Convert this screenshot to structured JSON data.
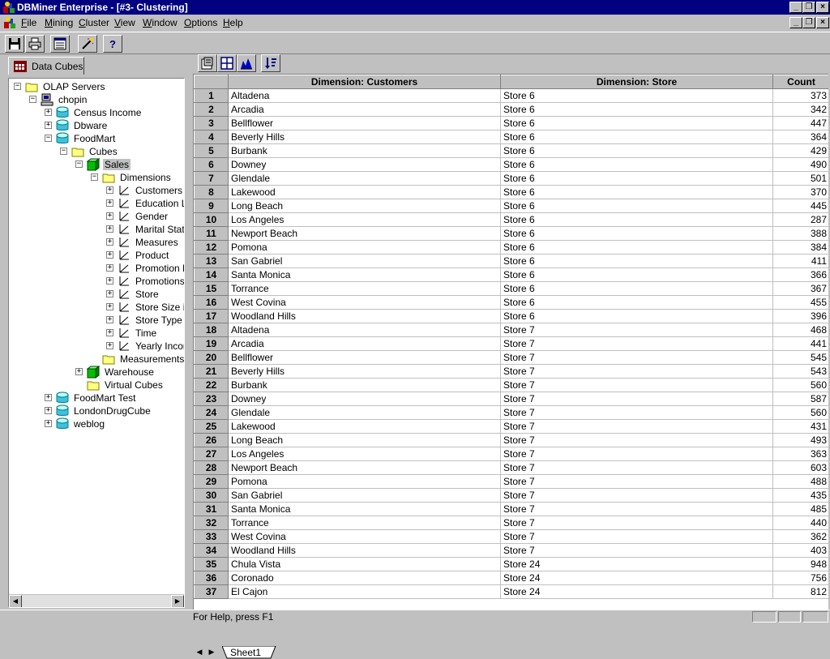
{
  "window": {
    "title": "DBMiner Enterprise - [#3- Clustering]"
  },
  "menu": [
    {
      "label": "File",
      "accel": "F",
      "rest": "ile"
    },
    {
      "label": "Mining",
      "accel": "M",
      "rest": "ining"
    },
    {
      "label": "Cluster",
      "accel": "C",
      "rest": "luster"
    },
    {
      "label": "View",
      "accel": "V",
      "rest": "iew"
    },
    {
      "label": "Window",
      "accel": "W",
      "rest": "indow"
    },
    {
      "label": "Options",
      "accel": "O",
      "rest": "ptions"
    },
    {
      "label": "Help",
      "accel": "H",
      "rest": "elp"
    }
  ],
  "toolbar": {
    "icons": [
      "save-icon",
      "print-icon",
      "properties-icon",
      "wizard-icon",
      "help-icon"
    ],
    "help_glyph": "?"
  },
  "left_panel": {
    "tab_label": "Data Cubes",
    "tree": [
      {
        "label": "OLAP Servers",
        "level": 0,
        "icon": "folder-icon",
        "expander": "minus"
      },
      {
        "label": "chopin",
        "level": 1,
        "icon": "server-icon",
        "expander": "minus"
      },
      {
        "label": "Census Income",
        "level": 2,
        "icon": "database-icon",
        "expander": "plus"
      },
      {
        "label": "Dbware",
        "level": 2,
        "icon": "database-icon",
        "expander": "plus"
      },
      {
        "label": "FoodMart",
        "level": 2,
        "icon": "database-icon",
        "expander": "minus"
      },
      {
        "label": "Cubes",
        "level": 3,
        "icon": "folder-icon",
        "expander": "minus"
      },
      {
        "label": "Sales",
        "level": 4,
        "icon": "cube-icon",
        "expander": "minus",
        "selected": true
      },
      {
        "label": "Dimensions",
        "level": 5,
        "icon": "folder-icon",
        "expander": "minus"
      },
      {
        "label": "Customers",
        "level": 6,
        "icon": "dimension-icon",
        "expander": "plus"
      },
      {
        "label": "Education L",
        "level": 6,
        "icon": "dimension-icon",
        "expander": "plus"
      },
      {
        "label": "Gender",
        "level": 6,
        "icon": "dimension-icon",
        "expander": "plus"
      },
      {
        "label": "Marital Statu",
        "level": 6,
        "icon": "dimension-icon",
        "expander": "plus"
      },
      {
        "label": "Measures",
        "level": 6,
        "icon": "dimension-icon",
        "expander": "plus"
      },
      {
        "label": "Product",
        "level": 6,
        "icon": "dimension-icon",
        "expander": "plus"
      },
      {
        "label": "Promotion M",
        "level": 6,
        "icon": "dimension-icon",
        "expander": "plus"
      },
      {
        "label": "Promotions",
        "level": 6,
        "icon": "dimension-icon",
        "expander": "plus"
      },
      {
        "label": "Store",
        "level": 6,
        "icon": "dimension-icon",
        "expander": "plus"
      },
      {
        "label": "Store Size ir",
        "level": 6,
        "icon": "dimension-icon",
        "expander": "plus"
      },
      {
        "label": "Store Type",
        "level": 6,
        "icon": "dimension-icon",
        "expander": "plus"
      },
      {
        "label": "Time",
        "level": 6,
        "icon": "dimension-icon",
        "expander": "plus"
      },
      {
        "label": "Yearly Incor",
        "level": 6,
        "icon": "dimension-icon",
        "expander": "plus"
      },
      {
        "label": "Measurements",
        "level": 5,
        "icon": "folder-icon",
        "expander": "none"
      },
      {
        "label": "Warehouse",
        "level": 4,
        "icon": "cube-icon",
        "expander": "plus"
      },
      {
        "label": "Virtual Cubes",
        "level": 4,
        "icon": "folder-icon",
        "expander": "none"
      },
      {
        "label": "FoodMart Test",
        "level": 2,
        "icon": "database-icon",
        "expander": "plus"
      },
      {
        "label": "LondonDrugCube",
        "level": 2,
        "icon": "database-icon",
        "expander": "plus"
      },
      {
        "label": "weblog",
        "level": 2,
        "icon": "database-icon",
        "expander": "plus"
      }
    ]
  },
  "grid": {
    "toolbar_icons": [
      "cube-properties-icon",
      "grid-view-icon",
      "cluster-chart-icon",
      "sort-icon"
    ],
    "columns": [
      "Dimension: Customers",
      "Dimension: Store",
      "Count"
    ],
    "rows": [
      [
        "1",
        "Altadena",
        "Store 6",
        "373"
      ],
      [
        "2",
        "Arcadia",
        "Store 6",
        "342"
      ],
      [
        "3",
        "Bellflower",
        "Store 6",
        "447"
      ],
      [
        "4",
        "Beverly Hills",
        "Store 6",
        "364"
      ],
      [
        "5",
        "Burbank",
        "Store 6",
        "429"
      ],
      [
        "6",
        "Downey",
        "Store 6",
        "490"
      ],
      [
        "7",
        "Glendale",
        "Store 6",
        "501"
      ],
      [
        "8",
        "Lakewood",
        "Store 6",
        "370"
      ],
      [
        "9",
        "Long Beach",
        "Store 6",
        "445"
      ],
      [
        "10",
        "Los Angeles",
        "Store 6",
        "287"
      ],
      [
        "11",
        "Newport Beach",
        "Store 6",
        "388"
      ],
      [
        "12",
        "Pomona",
        "Store 6",
        "384"
      ],
      [
        "13",
        "San Gabriel",
        "Store 6",
        "411"
      ],
      [
        "14",
        "Santa Monica",
        "Store 6",
        "366"
      ],
      [
        "15",
        "Torrance",
        "Store 6",
        "367"
      ],
      [
        "16",
        "West Covina",
        "Store 6",
        "455"
      ],
      [
        "17",
        "Woodland Hills",
        "Store 6",
        "396"
      ],
      [
        "18",
        "Altadena",
        "Store 7",
        "468"
      ],
      [
        "19",
        "Arcadia",
        "Store 7",
        "441"
      ],
      [
        "20",
        "Bellflower",
        "Store 7",
        "545"
      ],
      [
        "21",
        "Beverly Hills",
        "Store 7",
        "543"
      ],
      [
        "22",
        "Burbank",
        "Store 7",
        "560"
      ],
      [
        "23",
        "Downey",
        "Store 7",
        "587"
      ],
      [
        "24",
        "Glendale",
        "Store 7",
        "560"
      ],
      [
        "25",
        "Lakewood",
        "Store 7",
        "431"
      ],
      [
        "26",
        "Long Beach",
        "Store 7",
        "493"
      ],
      [
        "27",
        "Los Angeles",
        "Store 7",
        "363"
      ],
      [
        "28",
        "Newport Beach",
        "Store 7",
        "603"
      ],
      [
        "29",
        "Pomona",
        "Store 7",
        "488"
      ],
      [
        "30",
        "San Gabriel",
        "Store 7",
        "435"
      ],
      [
        "31",
        "Santa Monica",
        "Store 7",
        "485"
      ],
      [
        "32",
        "Torrance",
        "Store 7",
        "440"
      ],
      [
        "33",
        "West Covina",
        "Store 7",
        "362"
      ],
      [
        "34",
        "Woodland Hills",
        "Store 7",
        "403"
      ],
      [
        "35",
        "Chula Vista",
        "Store 24",
        "948"
      ],
      [
        "36",
        "Coronado",
        "Store 24",
        "756"
      ],
      [
        "37",
        "El Cajon",
        "Store 24",
        "812"
      ]
    ],
    "sheet_tab": "Sheet1"
  },
  "status": {
    "text": "For Help, press F1"
  },
  "colors": {
    "title_bar": "#000080",
    "face": "#c0c0c0",
    "window": "#ffffff"
  }
}
